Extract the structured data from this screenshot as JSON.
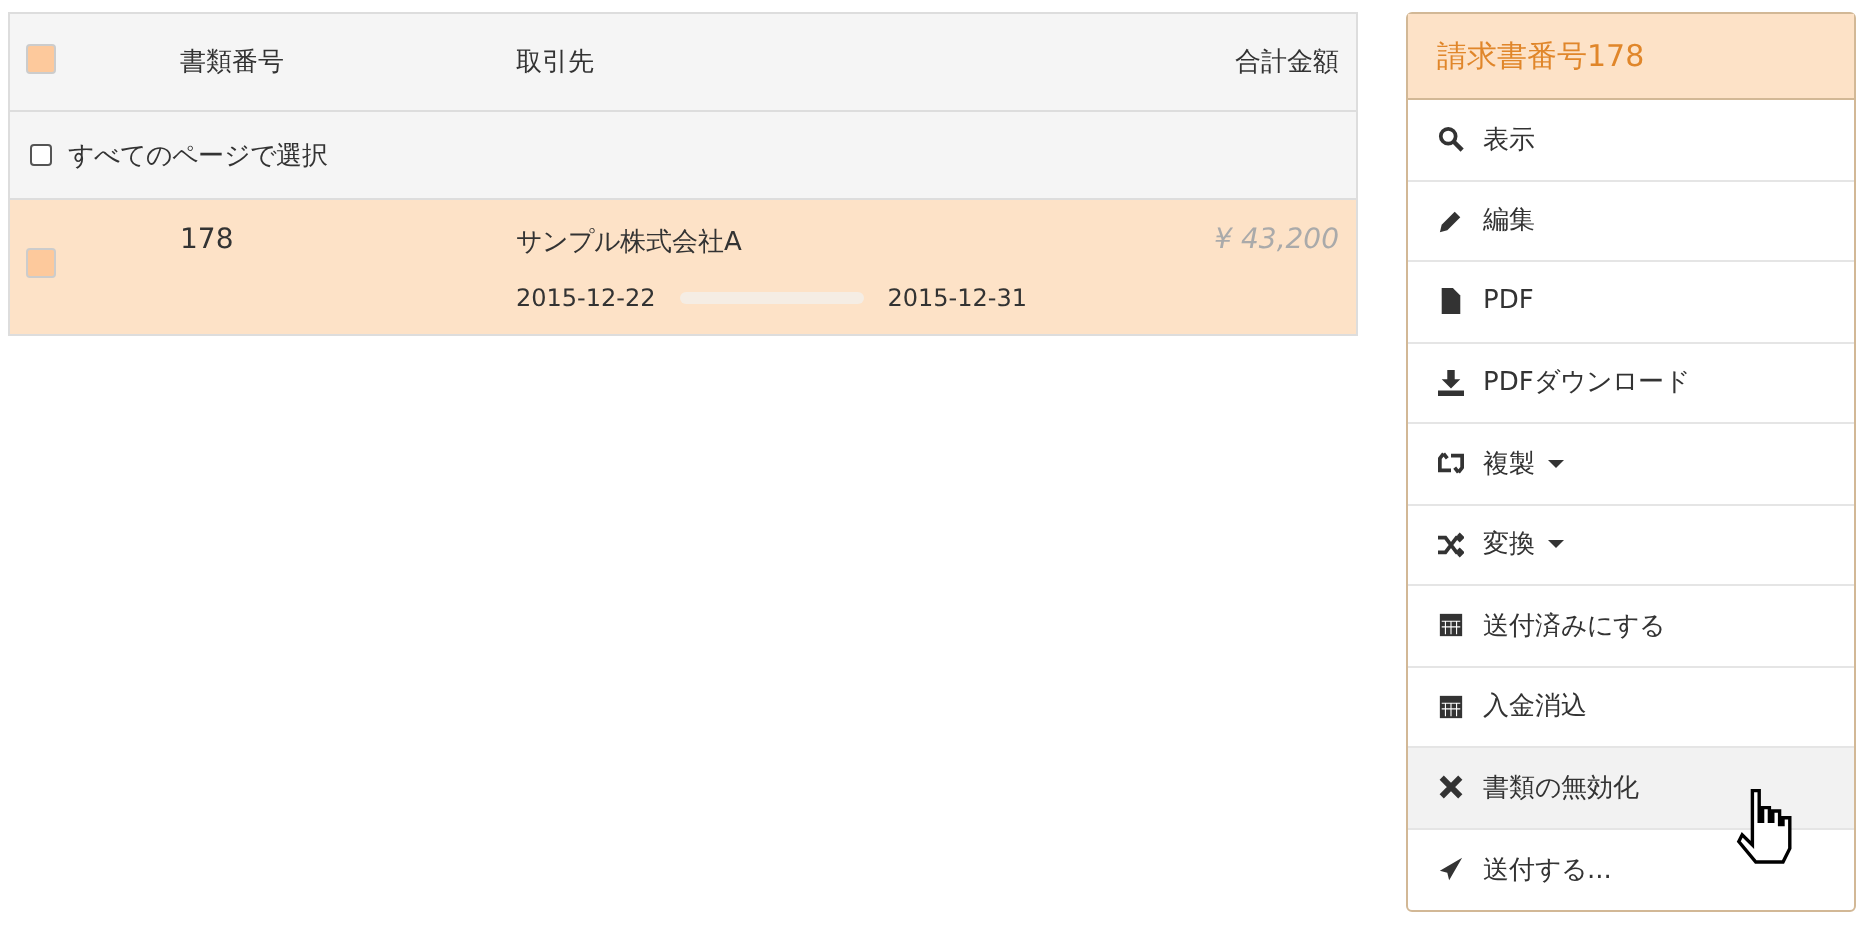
{
  "table": {
    "header_checked": true,
    "columns": [
      "書類番号",
      "取引先",
      "合計金額"
    ],
    "select_all": {
      "label": "すべてのページで選択",
      "checked": false
    },
    "rows": [
      {
        "checked": true,
        "number": "178",
        "client": "サンプル株式会社A",
        "amount": "¥ 43,200",
        "start_date": "2015-12-22",
        "end_date": "2015-12-31"
      }
    ]
  },
  "menu": {
    "title": "請求書番号178",
    "items": [
      {
        "kind": "search",
        "label": "表示",
        "caret": false,
        "selected": false
      },
      {
        "kind": "pencil",
        "label": "編集",
        "caret": false,
        "selected": false
      },
      {
        "kind": "file",
        "label": "PDF",
        "caret": false,
        "selected": false
      },
      {
        "kind": "download",
        "label": "PDFダウンロード",
        "caret": false,
        "selected": false
      },
      {
        "kind": "retweet",
        "label": "複製",
        "caret": true,
        "selected": false
      },
      {
        "kind": "shuffle",
        "label": "変換",
        "caret": true,
        "selected": false
      },
      {
        "kind": "calendar",
        "label": "送付済みにする",
        "caret": false,
        "selected": false
      },
      {
        "kind": "calendar",
        "label": "入金消込",
        "caret": false,
        "selected": false
      },
      {
        "kind": "times",
        "label": "書類の無効化",
        "caret": false,
        "selected": true
      },
      {
        "kind": "send",
        "label": "送付する...",
        "caret": false,
        "selected": false
      }
    ]
  }
}
